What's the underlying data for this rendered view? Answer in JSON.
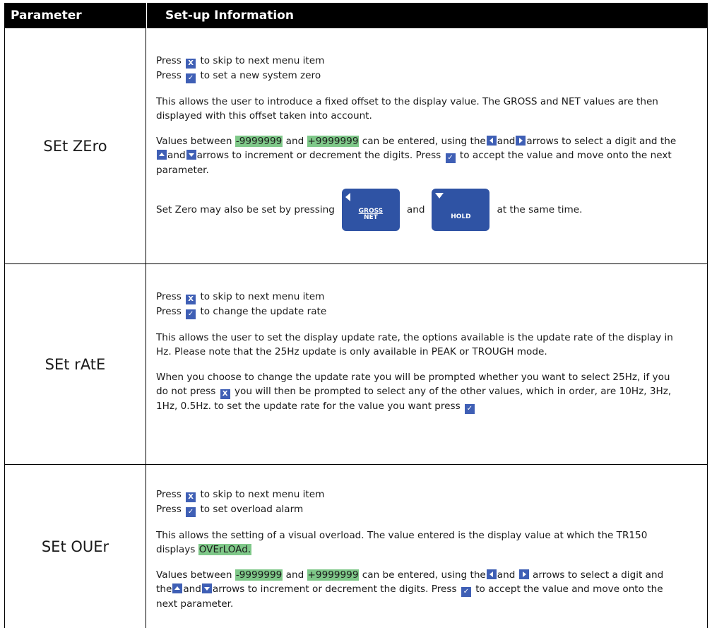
{
  "header": {
    "col1": "Parameter",
    "col2": "Set-up Information"
  },
  "rows": [
    {
      "param": "SEt ZEro",
      "press_x": "Press",
      "press_x_tail": "to skip to next menu item",
      "press_check": "Press",
      "press_check_tail": "to set a new system zero",
      "desc": "This allows the user to introduce a fixed offset to the display value. The GROSS and NET values are then displayed with this offset taken into account.",
      "values_a": "Values between",
      "min": "-9999999",
      "and": "and",
      "max": "+9999999",
      "values_b": "can be entered, using the",
      "values_c": "and",
      "values_d": "arrows to select a digit and the",
      "values_e": "and",
      "values_f": "arrows to increment or decrement the digits. Press",
      "values_g": "to accept the value and move onto the next parameter.",
      "setzero_a": "Set Zero may also be set by pressing",
      "setzero_b": "and",
      "setzero_c": "at the same time.",
      "key1_top": "GROSS",
      "key1_bottom": "NET",
      "key2": "HOLD"
    },
    {
      "param": "SEt rAtE",
      "press_x": "Press",
      "press_x_tail": "to skip to next menu item",
      "press_check": "Press",
      "press_check_tail": "to change the update rate",
      "desc": "This allows the user to set the display update rate, the options available is the update rate of the display in Hz. Please note that the 25Hz update is only available in PEAK or TROUGH mode.",
      "rate_a": "When you choose to change the update rate you will be prompted whether you want to select 25Hz, if you do not press",
      "rate_b": "you will then be prompted to select any of the other values, which in order, are 10Hz, 3Hz, 1Hz, 0.5Hz. to set the update rate for the value you want press"
    },
    {
      "param": "SEt OUEr",
      "press_x": "Press",
      "press_x_tail": "to skip to next menu item",
      "press_check": "Press",
      "press_check_tail": "to set overload alarm",
      "desc_a": "This allows the setting of a visual overload. The value entered is the display value at which the TR150 displays",
      "overload": "OVErLOAd.",
      "values_a": "Values between",
      "min": "-9999999",
      "and": "and",
      "max": "+9999999",
      "values_b": "can be entered, using the",
      "values_c": "and",
      "values_d": "arrows to select a digit and the",
      "values_e": "and",
      "values_f": "arrows to increment or decrement the digits. Press",
      "values_g": "to accept the value and move onto the next parameter."
    }
  ],
  "icons": {
    "x_key": "X",
    "check_key": "✓"
  },
  "colors": {
    "key_blue": "#3f5fb5",
    "highlight_green": "#7fc889"
  }
}
